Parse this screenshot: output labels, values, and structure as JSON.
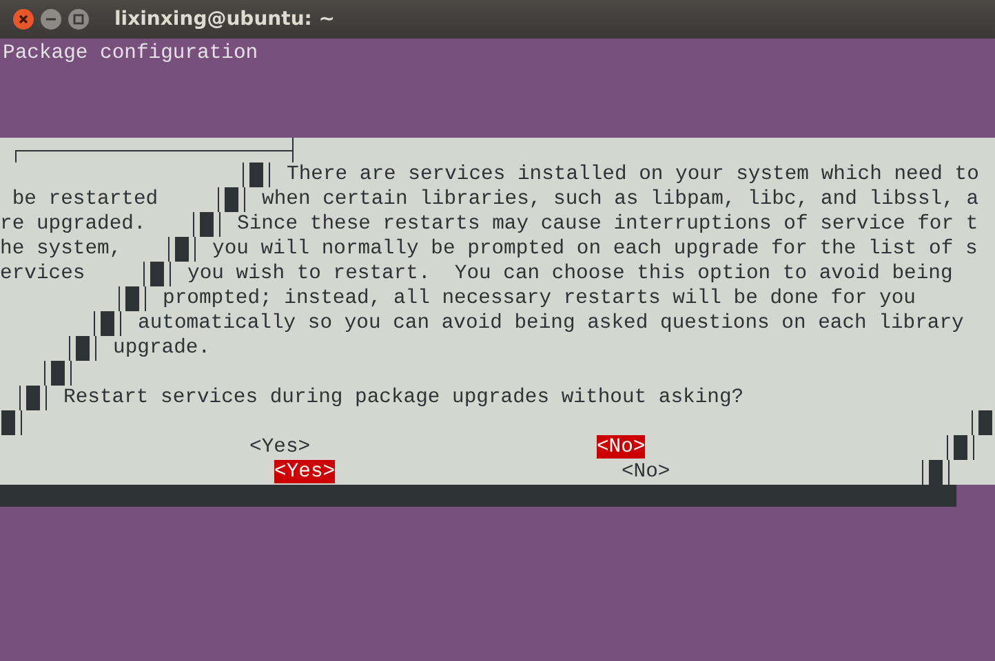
{
  "window": {
    "title": "lixinxing@ubuntu: ~"
  },
  "terminal": {
    "heading": "Package configuration"
  },
  "dialog": {
    "lines": [
      {
        "text": "There are services installed on your system which need to"
      },
      {
        "fragment": " be restarted",
        "text": "when certain libraries, such as libpam, libc, and libssl, a"
      },
      {
        "fragment": "re upgraded.",
        "text": "Since these restarts may cause interruptions of service for t"
      },
      {
        "fragment": "he system,",
        "text": "you will normally be prompted on each upgrade for the list of s"
      },
      {
        "fragment": "ervices",
        "text": "you wish to restart.  You can choose this option to avoid being"
      },
      {
        "text": "prompted; instead, all necessary restarts will be done for you"
      },
      {
        "text": "automatically so you can avoid being asked questions on each library"
      },
      {
        "text": "upgrade."
      }
    ],
    "question": "Restart services during package upgrades without asking?",
    "button_rows": [
      [
        {
          "label": "<Yes>",
          "selected": false
        },
        {
          "label": "<No>",
          "selected": true
        }
      ],
      [
        {
          "label": "<Yes>",
          "selected": true
        },
        {
          "label": "<No>",
          "selected": false
        }
      ]
    ]
  }
}
